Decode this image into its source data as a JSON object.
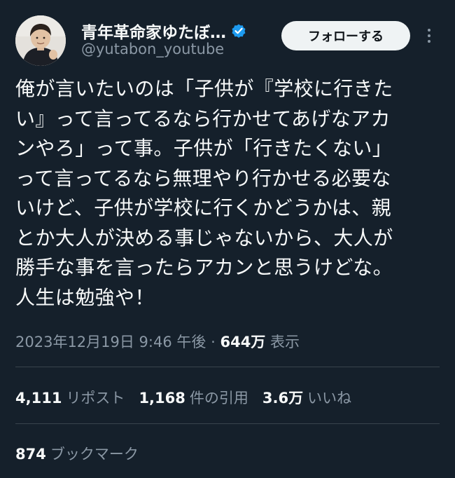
{
  "author": {
    "display_name": "青年革命家ゆたぼ…",
    "handle": "@yutabon_youtube",
    "verified": true,
    "avatar": "avatar-photo"
  },
  "header": {
    "follow_label": "フォローする",
    "more_icon": "more-icon"
  },
  "tweet": {
    "text": "俺が言いたいのは「子供が『学校に行きた\nい』って言ってるなら行かせてあげなアカ\nンやろ」って事。子供が「行きたくない」\nって言ってるなら無理やり行かせる必要な\nいけど、子供が学校に行くかどうかは、親\nとか大人が決める事じゃないから、大人が\n勝手な事を言ったらアカンと思うけどな。\n人生は勉強や！"
  },
  "meta": {
    "timestamp": "2023年12月19日 9:46 午後",
    "separator": "·",
    "views_count": "644万",
    "views_label": "表示"
  },
  "stats": {
    "reposts_count": "4,111",
    "reposts_label": "リポスト",
    "quotes_count": "1,168",
    "quotes_label": "件の引用",
    "likes_count": "3.6万",
    "likes_label": "いいね",
    "bookmarks_count": "874",
    "bookmarks_label": "ブックマーク"
  },
  "colors": {
    "background": "#15202b",
    "text_primary": "#f7f9f9",
    "text_secondary": "#8b98a5",
    "verified_badge": "#1d9bf0",
    "follow_button_bg": "#eff3f4",
    "divider": "#38444d"
  }
}
